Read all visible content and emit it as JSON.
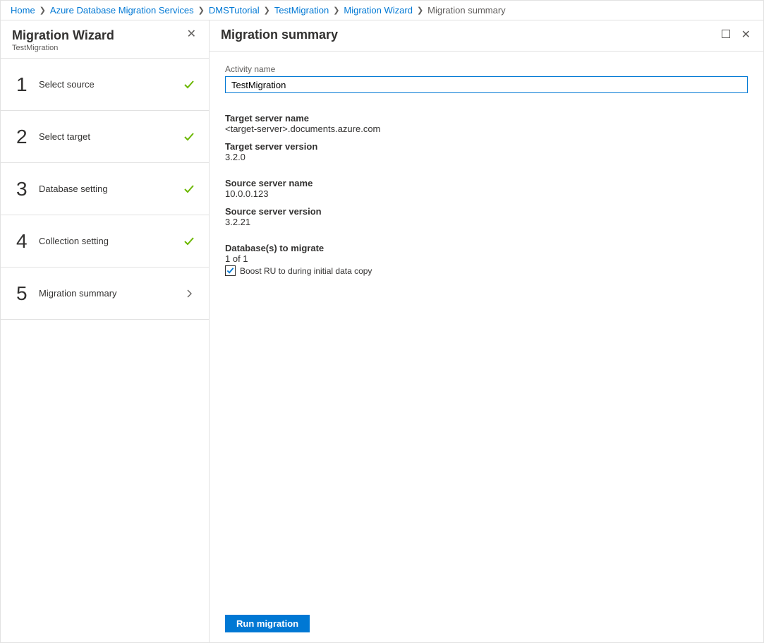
{
  "breadcrumb": {
    "items": [
      {
        "label": "Home",
        "link": true
      },
      {
        "label": "Azure Database Migration Services",
        "link": true
      },
      {
        "label": "DMSTutorial",
        "link": true
      },
      {
        "label": "TestMigration",
        "link": true
      },
      {
        "label": "Migration Wizard",
        "link": true
      },
      {
        "label": "Migration summary",
        "link": false
      }
    ]
  },
  "wizard": {
    "title": "Migration Wizard",
    "subtitle": "TestMigration",
    "steps": [
      {
        "num": "1",
        "label": "Select source",
        "status": "done"
      },
      {
        "num": "2",
        "label": "Select target",
        "status": "done"
      },
      {
        "num": "3",
        "label": "Database setting",
        "status": "done"
      },
      {
        "num": "4",
        "label": "Collection setting",
        "status": "done"
      },
      {
        "num": "5",
        "label": "Migration summary",
        "status": "current"
      }
    ]
  },
  "content": {
    "title": "Migration summary",
    "activity_name_label": "Activity name",
    "activity_name_value": "TestMigration",
    "target_server_name_label": "Target server name",
    "target_server_name_value": "<target-server>.documents.azure.com",
    "target_server_version_label": "Target server version",
    "target_server_version_value": "3.2.0",
    "source_server_name_label": "Source server name",
    "source_server_name_value": "10.0.0.123",
    "source_server_version_label": "Source server version",
    "source_server_version_value": "3.2.21",
    "databases_label": "Database(s) to migrate",
    "databases_value": "1 of 1",
    "boost_checkbox_label": "Boost RU to during initial data copy",
    "boost_checked": true,
    "run_button": "Run migration"
  }
}
